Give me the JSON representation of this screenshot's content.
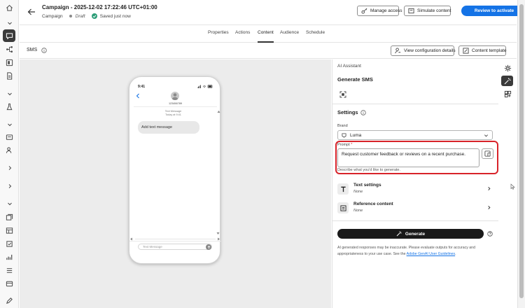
{
  "header": {
    "title": "Campaign - 2025-12-02 17:22:46 UTC+01:00",
    "type": "Campaign",
    "status": "Draft",
    "saved": "Saved just now",
    "manage_access": "Manage access",
    "simulate": "Simulate content",
    "review": "Review to activate"
  },
  "tabs": [
    "Properties",
    "Actions",
    "Content",
    "Audience",
    "Schedule"
  ],
  "active_tab": "Content",
  "channel": {
    "label": "SMS",
    "view_config": "View configuration details",
    "content_template": "Content template"
  },
  "phone": {
    "time": "9:41",
    "number": "123456789",
    "text_message": "Text Message",
    "today": "Today at 9:41",
    "bubble": "Add text message",
    "input_placeholder": "Text Message"
  },
  "assistant": {
    "label": "AI Assistant",
    "heading": "Generate SMS",
    "settings": "Settings",
    "brand_label": "Brand",
    "brand_value": "Luma",
    "prompt_label": "Prompt",
    "prompt_required": "*",
    "prompt_value": "Request customer feedback or reviews on a recent purchase.",
    "prompt_help": "Describe what you'd like to generate.",
    "text_settings": "Text settings",
    "text_settings_value": "None",
    "reference_content": "Reference content",
    "reference_content_value": "None",
    "generate": "Generate",
    "disclaimer": "AI generated responses may be inaccurate. Please evaluate outputs for accuracy and appropriateness to your use case. See the",
    "guidelines_link": "Adobe GenAI User Guidelines",
    "disclaimer_end": "."
  },
  "icons": {
    "left_rail": [
      "home-icon",
      "chevron-down-icon",
      "messages-icon",
      "journey-icon",
      "channels-icon",
      "document-icon",
      "chevron-down-icon",
      "experiment-icon",
      "chevron-down-icon",
      "decisions-icon",
      "audience-icon",
      "chevron-right-icon",
      "chevron-right-icon",
      "content-icon",
      "templates-icon",
      "fragments-icon",
      "reports-icon",
      "logs-icon",
      "lists-icon",
      "edit-icon"
    ],
    "right_toolbar": [
      "gear-icon",
      "ai-wand-icon",
      "assets-icon"
    ]
  },
  "colors": {
    "accent": "#1473e6",
    "highlight": "#d8232a",
    "saved": "#2d9d78",
    "generate_button": "#1a1a1a"
  }
}
